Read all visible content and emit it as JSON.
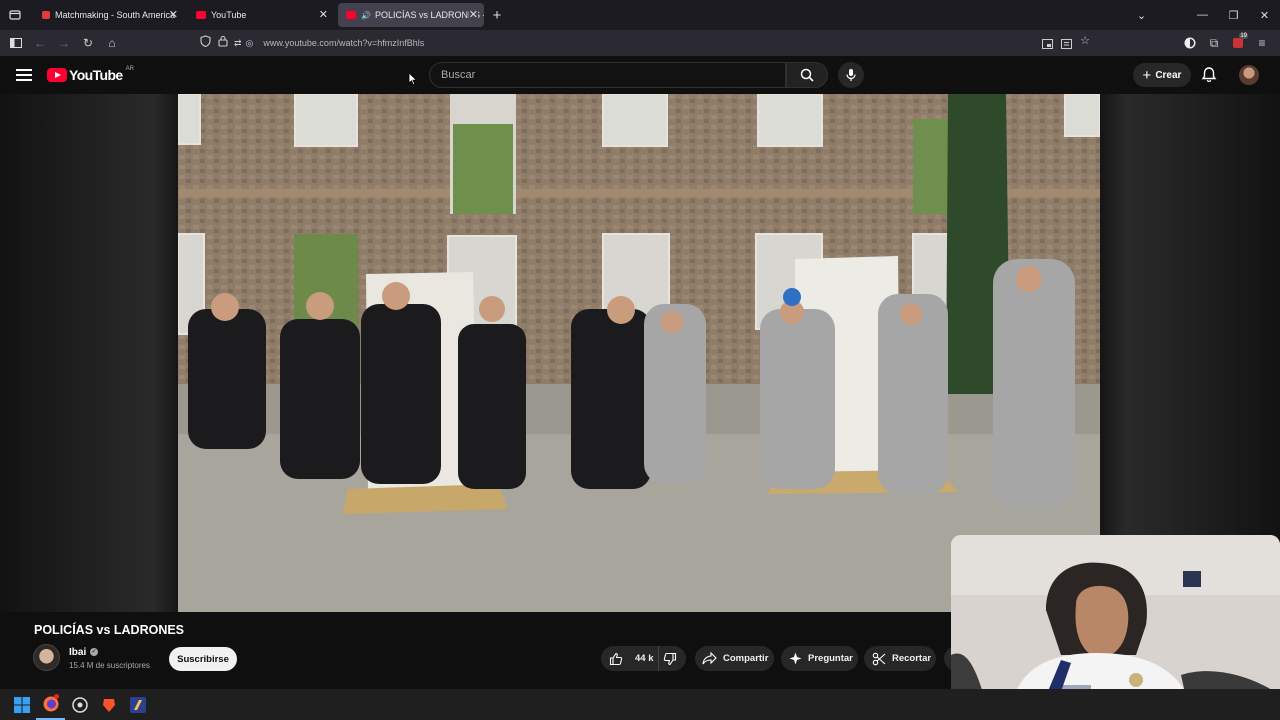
{
  "browser": {
    "tabs": [
      {
        "title": "Matchmaking - South America",
        "active": false
      },
      {
        "title": "YouTube",
        "active": false
      },
      {
        "title": "POLICÍAS vs LADRONES - Y",
        "active": true
      }
    ],
    "url": "www.youtube.com/watch?v=hfmzInfBhls",
    "notification_badge": "19"
  },
  "youtube": {
    "logo_text": "YouTube",
    "country_code": "AR",
    "search_placeholder": "Buscar",
    "create_label": "Crear"
  },
  "video": {
    "title": "POLICÍAS vs LADRONES",
    "channel": "Ibai",
    "subscribers": "15.4 M de suscriptores",
    "subscribe_label": "Suscribirse",
    "likes": "44 k",
    "share_label": "Compartir",
    "ask_label": "Preguntar",
    "clip_label": "Recortar"
  },
  "taskbar": {
    "icons": [
      "windows-start-icon",
      "firefox-icon",
      "chrome-like-icon",
      "brave-icon",
      "app-icon"
    ]
  },
  "colors": {
    "youtube_red": "#ff0033",
    "page_bg": "#0f0f0f",
    "pill_bg": "#272727"
  }
}
